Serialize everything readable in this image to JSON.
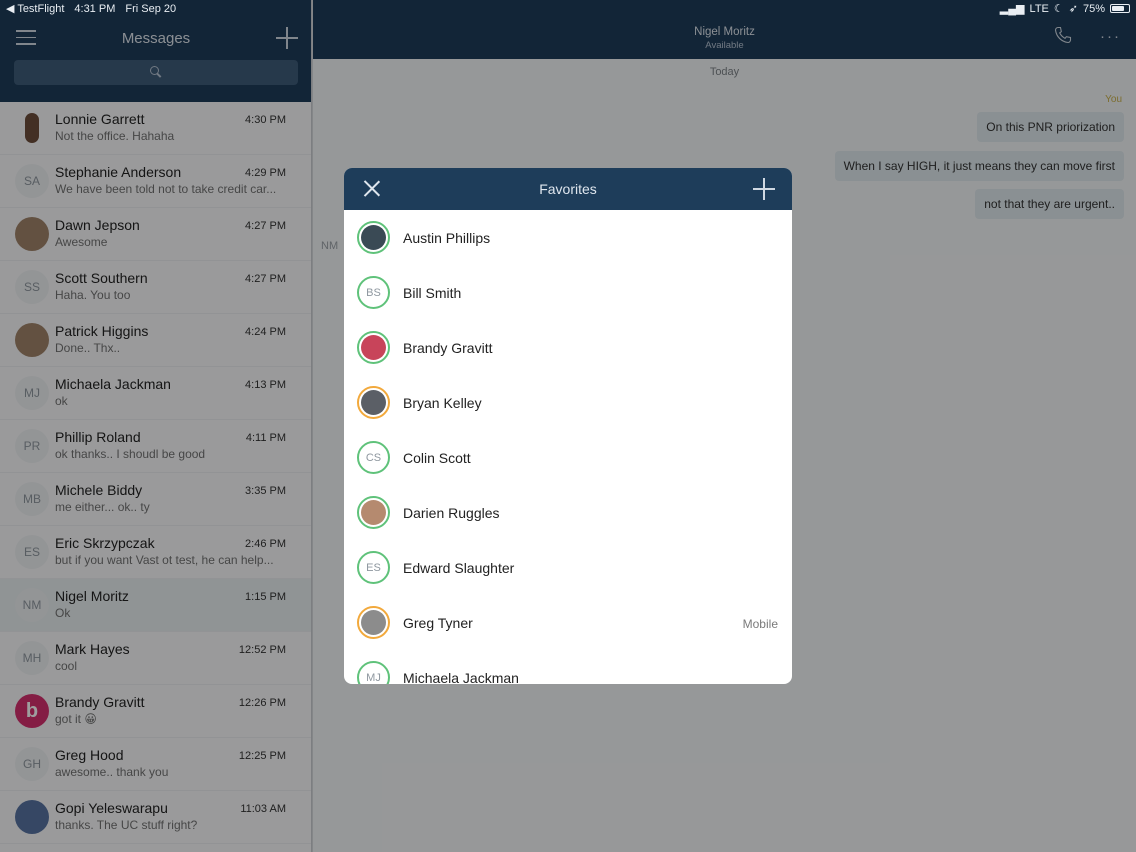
{
  "status_bar": {
    "back_app": "◀ TestFlight",
    "time": "4:31 PM",
    "date": "Fri Sep 20",
    "network": "LTE",
    "battery": "75%",
    "battery_level": 0.75
  },
  "sidebar": {
    "title": "Messages",
    "search_placeholder": "",
    "conversations": [
      {
        "name": "Lonnie Garrett",
        "preview": "Not the office. Hahaha",
        "time": "4:30 PM",
        "initials": "",
        "avatar": "photo"
      },
      {
        "name": "Stephanie Anderson",
        "preview": "We have been told not to take credit car...",
        "time": "4:29 PM",
        "initials": "SA",
        "avatar": "initials"
      },
      {
        "name": "Dawn Jepson",
        "preview": "Awesome",
        "time": "4:27 PM",
        "initials": "",
        "avatar": "photo"
      },
      {
        "name": "Scott Southern",
        "preview": "Haha. You too",
        "time": "4:27 PM",
        "initials": "SS",
        "avatar": "initials"
      },
      {
        "name": "Patrick Higgins",
        "preview": "Done..  Thx..",
        "time": "4:24 PM",
        "initials": "",
        "avatar": "photo"
      },
      {
        "name": "Michaela Jackman",
        "preview": "ok",
        "time": "4:13 PM",
        "initials": "MJ",
        "avatar": "initials"
      },
      {
        "name": "Phillip Roland",
        "preview": "ok thanks.. I shoudl be good",
        "time": "4:11 PM",
        "initials": "PR",
        "avatar": "initials"
      },
      {
        "name": "Michele Biddy",
        "preview": "me either... ok.. ty",
        "time": "3:35 PM",
        "initials": "MB",
        "avatar": "initials"
      },
      {
        "name": "Eric Skrzypczak",
        "preview": "but if you want Vast ot test, he can help...",
        "time": "2:46 PM",
        "initials": "ES",
        "avatar": "initials"
      },
      {
        "name": "Nigel Moritz",
        "preview": "Ok",
        "time": "1:15 PM",
        "initials": "NM",
        "avatar": "initials",
        "active": true
      },
      {
        "name": "Mark Hayes",
        "preview": "cool",
        "time": "12:52 PM",
        "initials": "MH",
        "avatar": "initials"
      },
      {
        "name": "Brandy Gravitt",
        "preview": "got it 😀",
        "time": "12:26 PM",
        "initials": "b",
        "avatar": "pink"
      },
      {
        "name": "Greg Hood",
        "preview": "awesome.. thank you",
        "time": "12:25 PM",
        "initials": "GH",
        "avatar": "initials"
      },
      {
        "name": "Gopi Yeleswarapu",
        "preview": "thanks. The UC stuff right?",
        "time": "11:03 AM",
        "initials": "",
        "avatar": "blue"
      }
    ]
  },
  "chat": {
    "contact_name": "Nigel Moritz",
    "contact_status": "Available",
    "day_label": "Today",
    "sender_label": "You",
    "incoming_initials": "NM",
    "messages": [
      "On this PNR priorization",
      "When I say HIGH, it just means they can move first",
      "not that they are urgent.."
    ]
  },
  "favorites_modal": {
    "title": "Favorites",
    "items": [
      {
        "name": "Austin Phillips",
        "initials": "",
        "ring": "green",
        "photo": "#3a4a55",
        "sub": ""
      },
      {
        "name": "Bill Smith",
        "initials": "BS",
        "ring": "green",
        "photo": "",
        "sub": ""
      },
      {
        "name": "Brandy Gravitt",
        "initials": "",
        "ring": "green",
        "photo": "#c8445a",
        "sub": ""
      },
      {
        "name": "Bryan Kelley",
        "initials": "",
        "ring": "orange",
        "photo": "#5b5f66",
        "sub": ""
      },
      {
        "name": "Colin Scott",
        "initials": "CS",
        "ring": "green",
        "photo": "",
        "sub": ""
      },
      {
        "name": "Darien Ruggles",
        "initials": "",
        "ring": "green",
        "photo": "#b58a6f",
        "sub": ""
      },
      {
        "name": "Edward Slaughter",
        "initials": "ES",
        "ring": "green",
        "photo": "",
        "sub": ""
      },
      {
        "name": "Greg Tyner",
        "initials": "",
        "ring": "orange",
        "photo": "#8c8c8c",
        "sub": "Mobile"
      },
      {
        "name": "Michaela Jackman",
        "initials": "MJ",
        "ring": "green",
        "photo": "",
        "sub": ""
      }
    ]
  },
  "colors": {
    "header": "#1e3d5a",
    "ring_green": "#5fc27a",
    "ring_orange": "#f2a93c",
    "bubble": "#dfe9ed"
  }
}
